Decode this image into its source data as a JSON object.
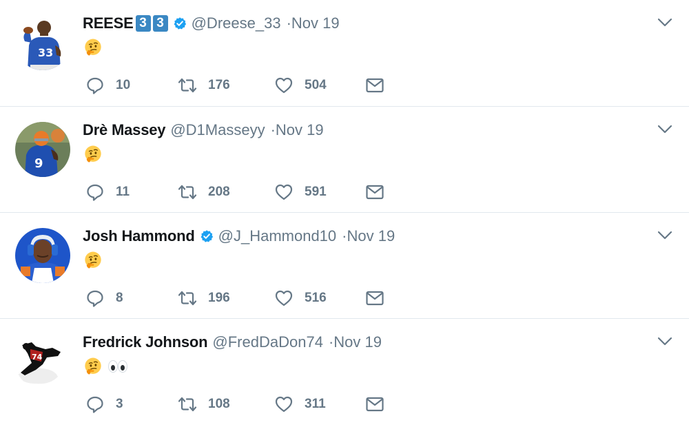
{
  "colors": {
    "text_primary": "#14171a",
    "text_secondary": "#657786",
    "verified_blue": "#1da1f2",
    "divider": "#e1e8ed",
    "icon_gray": "#657786"
  },
  "tweets": [
    {
      "name": "REESE",
      "name_badges": [
        "3",
        "3"
      ],
      "verified": true,
      "handle": "@Dreese_33",
      "dot": "·",
      "time": "Nov 19",
      "content": "🤔",
      "replies": "10",
      "retweets": "176",
      "likes": "504"
    },
    {
      "name": "Drè Massey",
      "name_badges": [],
      "verified": false,
      "handle": "@D1Masseyy",
      "dot": "·",
      "time": "Nov 19",
      "content": "🤔",
      "replies": "11",
      "retweets": "208",
      "likes": "591"
    },
    {
      "name": "Josh Hammond",
      "name_badges": [],
      "verified": true,
      "handle": "@J_Hammond10",
      "dot": "·",
      "time": "Nov 19",
      "content": "🤔",
      "replies": "8",
      "retweets": "196",
      "likes": "516"
    },
    {
      "name": "Fredrick Johnson",
      "name_badges": [],
      "verified": false,
      "handle": "@FredDaDon74",
      "dot": "·",
      "time": "Nov 19",
      "content": "🤔👀",
      "replies": "3",
      "retweets": "108",
      "likes": "311"
    }
  ],
  "icons": {
    "reply": "reply-icon",
    "retweet": "retweet-icon",
    "like": "heart-icon",
    "dm": "envelope-icon",
    "more": "chevron-down-icon",
    "verified": "verified-badge-icon"
  }
}
